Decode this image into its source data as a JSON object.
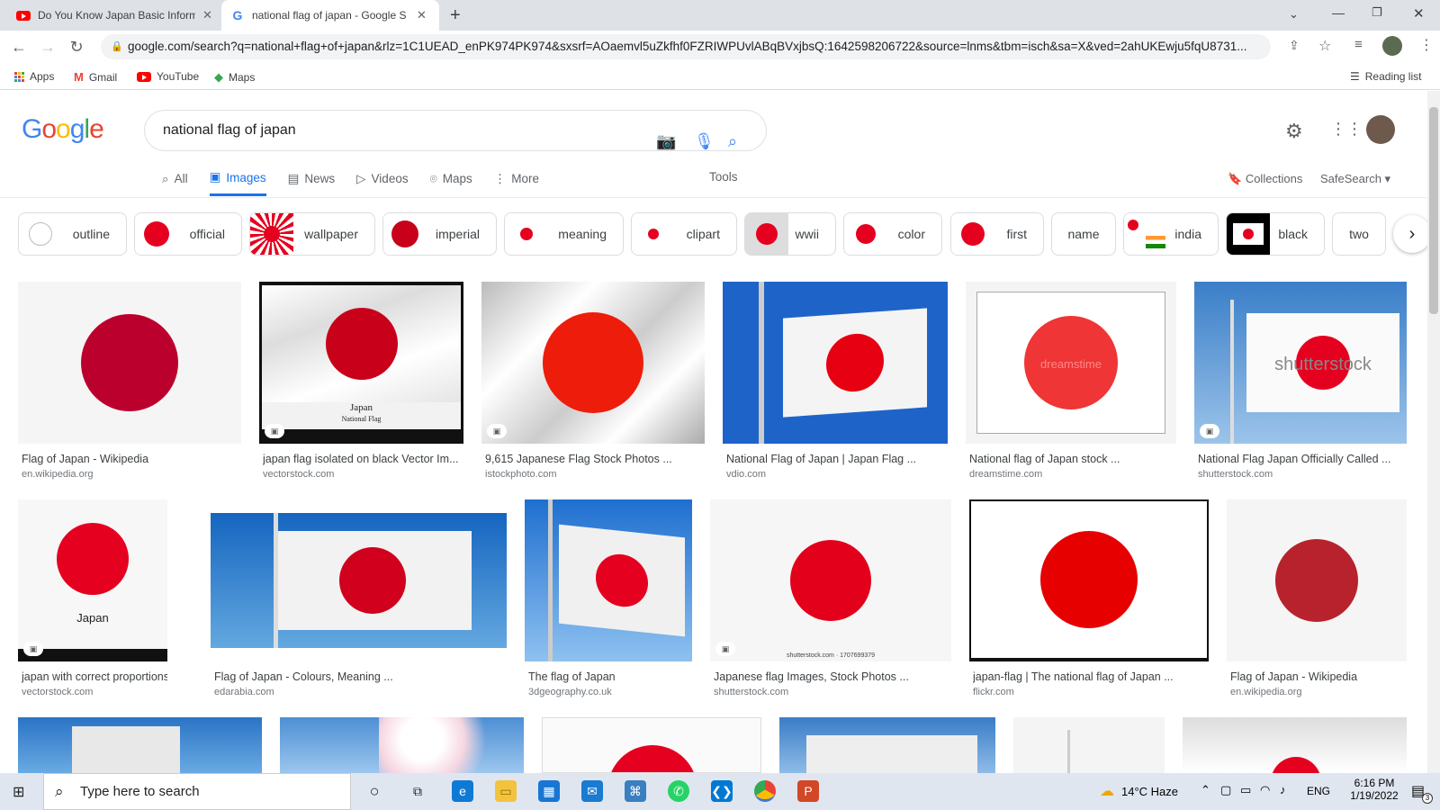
{
  "browser": {
    "tabs": [
      {
        "title": "Do You Know Japan Basic Inform",
        "icon": "youtube-icon"
      },
      {
        "title": "national flag of japan - Google S",
        "icon": "google-icon"
      }
    ],
    "url": "google.com/search?q=national+flag+of+japan&rlz=1C1UEAD_enPK974PK974&sxsrf=AOaemvl5uZkfhf0FZRIWPUvlABqBVxjbsQ:1642598206722&source=lnms&tbm=isch&sa=X&ved=2ahUKEwju5fqU8731...",
    "bookmarks": [
      "Apps",
      "Gmail",
      "YouTube",
      "Maps"
    ],
    "reading_list": "Reading list"
  },
  "search": {
    "query": "national flag of japan",
    "logo": "Google",
    "tabs": [
      "All",
      "Images",
      "News",
      "Videos",
      "Maps",
      "More"
    ],
    "active_tab": "Images",
    "tools": "Tools",
    "collections": "Collections",
    "safesearch": "SafeSearch"
  },
  "chips": [
    "outline",
    "official",
    "wallpaper",
    "imperial",
    "meaning",
    "clipart",
    "wwii",
    "color",
    "first",
    "name",
    "india",
    "black",
    "two"
  ],
  "results": [
    {
      "caption": "Flag of Japan - Wikipedia",
      "source": "en.wikipedia.org"
    },
    {
      "caption": "japan flag isolated on black Vector Im...",
      "source": "vectorstock.com",
      "label": "Japan",
      "sublabel": "National Flag"
    },
    {
      "caption": "9,615 Japanese Flag Stock Photos ...",
      "source": "istockphoto.com"
    },
    {
      "caption": "National Flag of Japan | Japan Flag ...",
      "source": "vdio.com"
    },
    {
      "caption": "National flag of Japan stock ...",
      "source": "dreamstime.com",
      "watermark": "dreamstime"
    },
    {
      "caption": "National Flag Japan Officially Called ...",
      "source": "shutterstock.com",
      "watermark": "shutterstock"
    },
    {
      "caption": "japan with correct proportions V...",
      "source": "vectorstock.com",
      "label": "Japan"
    },
    {
      "caption": "Flag of Japan - Colours, Meaning ...",
      "source": "edarabia.com"
    },
    {
      "caption": "The flag of Japan",
      "source": "3dgeography.co.uk"
    },
    {
      "caption": "Japanese flag Images, Stock Photos ...",
      "source": "shutterstock.com",
      "watermark": "shutterstock.com · 1707699379"
    },
    {
      "caption": "japan-flag | The national flag of Japan ...",
      "source": "flickr.com"
    },
    {
      "caption": "Flag of Japan - Wikipedia",
      "source": "en.wikipedia.org"
    }
  ],
  "taskbar": {
    "search_placeholder": "Type here to search",
    "weather": "14°C  Haze",
    "lang": "ENG",
    "time": "6:16 PM",
    "date": "1/19/2022",
    "notifications": "3"
  },
  "colors": {
    "flag_red": "#e5001f",
    "accent": "#1a73e8",
    "sky": "#1e64c8"
  }
}
